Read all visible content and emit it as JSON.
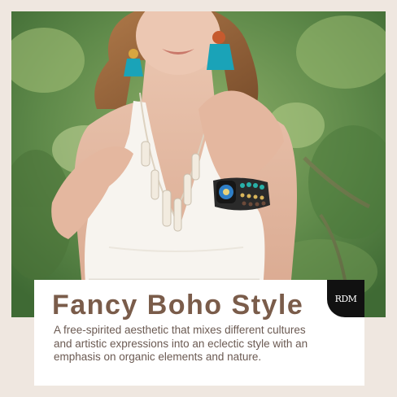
{
  "heading": "Fancy Boho Style",
  "description": "A free-spirited aesthetic that mixes different cultures and artistic expressions into an eclectic style with an emphasis on organic elements and nature.",
  "logo_text": "RDM",
  "colors": {
    "background": "#efe7e0",
    "heading": "#7a5c4a",
    "body_text": "#6b5a52",
    "foliage": "#5f8a4a",
    "dress": "#f7f4ef",
    "earring_tassel": "#1aa3b8",
    "logo_bg": "#111111"
  }
}
